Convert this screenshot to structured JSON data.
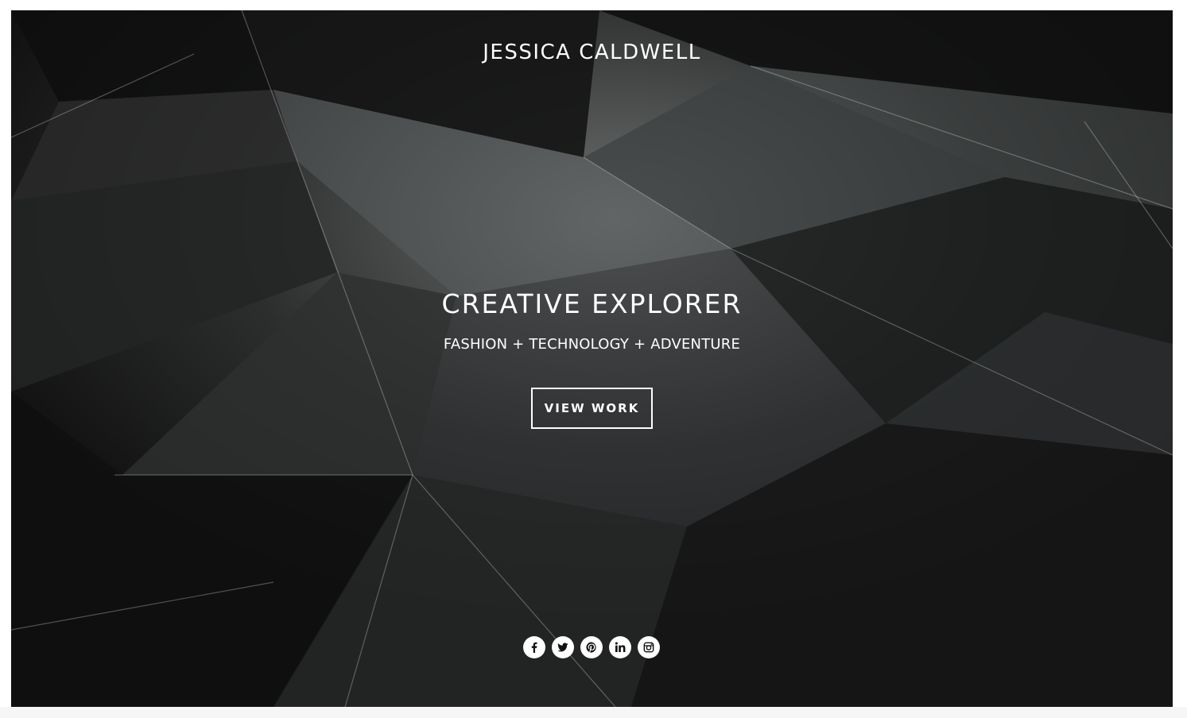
{
  "site": {
    "name": "JESSICA CALDWELL"
  },
  "hero": {
    "headline": "CREATIVE EXPLORER",
    "tagline": "FASHION + TECHNOLOGY + ADVENTURE",
    "cta_label": "VIEW WORK"
  },
  "social": [
    {
      "icon": "facebook-icon"
    },
    {
      "icon": "twitter-icon"
    },
    {
      "icon": "pinterest-icon"
    },
    {
      "icon": "linkedin-icon"
    },
    {
      "icon": "instagram-icon"
    }
  ],
  "colors": {
    "background": "#1b1b1b",
    "text": "#ffffff",
    "icon_fill": "#ffffff",
    "icon_glyph": "#111111"
  }
}
